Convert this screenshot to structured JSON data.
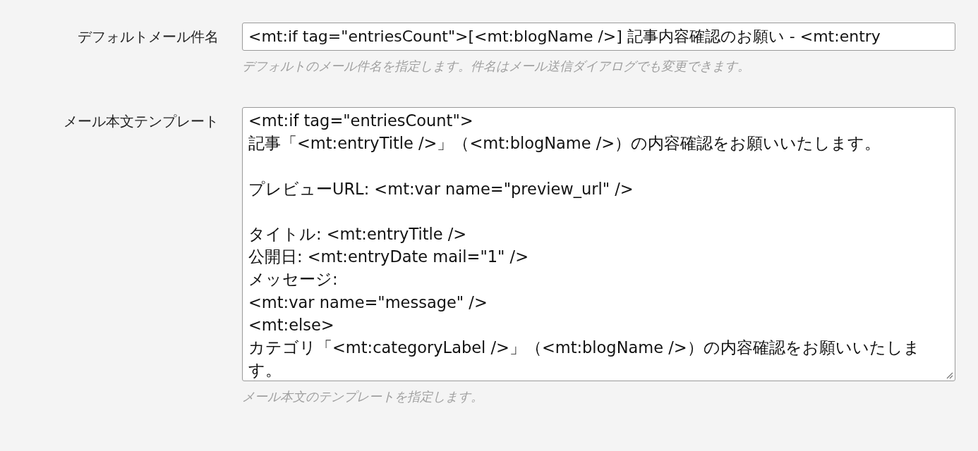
{
  "fields": [
    {
      "kind": "input",
      "label": "デフォルトメール件名",
      "value": "<mt:if tag=\"entriesCount\">[<mt:blogName />] 記事内容確認のお願い - <mt:entry",
      "help": "デフォルトのメール件名を指定します。件名はメール送信ダイアログでも変更できます。"
    },
    {
      "kind": "textarea",
      "label": "メール本文テンプレート",
      "paragraphs": [
        [
          "<mt:if tag=\"entriesCount\">",
          "記事「<mt:entryTitle />」（<mt:blogName />）の内容確認をお願いいたします。"
        ],
        [
          "プレビューURL: <mt:var name=\"preview_url\" />"
        ],
        [
          "タイトル: <mt:entryTitle />",
          "公開日: <mt:entryDate mail=\"1\" />",
          "メッセージ:",
          "<mt:var name=\"message\" />",
          "<mt:else>",
          "カテゴリ「<mt:categoryLabel />」（<mt:blogName />）の内容確認をお願いいたします。"
        ]
      ],
      "help": "メール本文のテンプレートを指定します。"
    }
  ]
}
